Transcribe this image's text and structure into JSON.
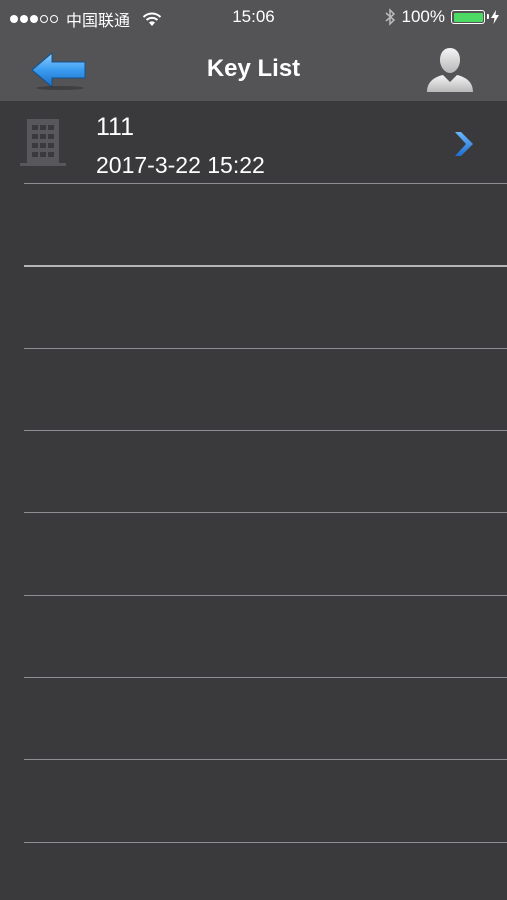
{
  "status_bar": {
    "carrier": "中国联通",
    "time": "15:06",
    "battery": "100%"
  },
  "nav": {
    "title": "Key List"
  },
  "keys": [
    {
      "name": "111",
      "date": "2017-3-22 15:22"
    }
  ],
  "colors": {
    "background": "#3a3a3c",
    "bar": "#545456",
    "accent": "#2f86e6",
    "battery": "#4cd964"
  },
  "icons": [
    "back-arrow-icon",
    "user-icon",
    "building-icon",
    "chevron-right-icon",
    "wifi-icon",
    "bluetooth-icon",
    "battery-icon",
    "charging-icon"
  ]
}
